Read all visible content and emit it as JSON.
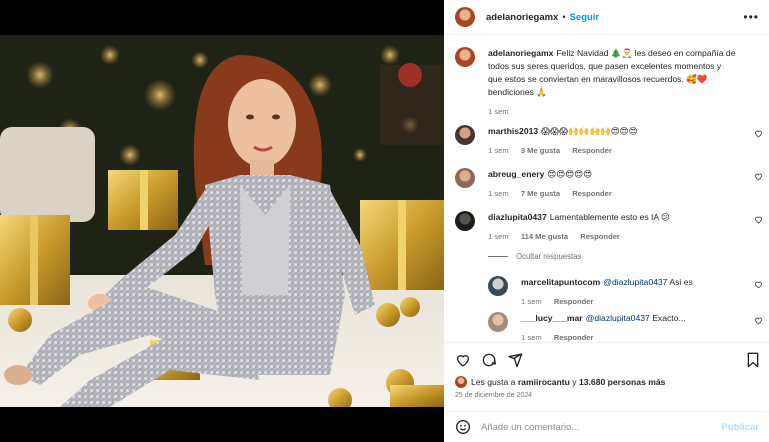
{
  "post": {
    "username": "adelanoriegamx",
    "follow_label": "Seguir",
    "dot": "•",
    "more": "•••",
    "caption_text": "Feliz Navidad 🎄🎅 les deseo en compañía de todos sus seres queridos, que pasen excelentes momentos y que estos se conviertan en maravillosos recuerdos. 🥰❤️ bendiciones 🙏",
    "caption_time": "1 sem"
  },
  "comments": [
    {
      "user": "marthis2013",
      "text": "😱😱😱🙌🙌🙌🙌😍😍😍",
      "time": "1 sem",
      "likes": "3 Me gusta",
      "reply": "Responder"
    },
    {
      "user": "abreug_enery",
      "text": "😍😍😍😍😍",
      "time": "1 sem",
      "likes": "7 Me gusta",
      "reply": "Responder"
    },
    {
      "user": "diazlupita0437",
      "text": "Lamentablemente esto es IA 😕",
      "time": "1 sem",
      "likes": "114 Me gusta",
      "reply": "Responder"
    }
  ],
  "hide_replies": "Ocultar respuestas",
  "replies": [
    {
      "user": "marcelitapuntocom",
      "mention": "@diazlupita0437",
      "text": "Asi es",
      "time": "1 sem",
      "reply": "Responder"
    },
    {
      "user": "___lucy___mar",
      "mention": "@diazlupita0437",
      "text": "Exacto...",
      "time": "1 sem",
      "reply": "Responder"
    }
  ],
  "likes": {
    "prefix": "Les gusta a",
    "user": "ramiirocantu",
    "joiner": "y",
    "count": "13.680 personas más"
  },
  "date": "25 de diciembre de 2024",
  "comment_box": {
    "placeholder": "Añade un comentario...",
    "publish": "Publicar"
  },
  "colors": {
    "accent": "#0095f6",
    "text": "#262626",
    "muted": "#737373",
    "publish_disabled": "#b3dbff"
  },
  "icons": [
    "heart-icon",
    "comment-icon",
    "share-icon",
    "bookmark-icon",
    "emoji-icon",
    "more-icon"
  ]
}
